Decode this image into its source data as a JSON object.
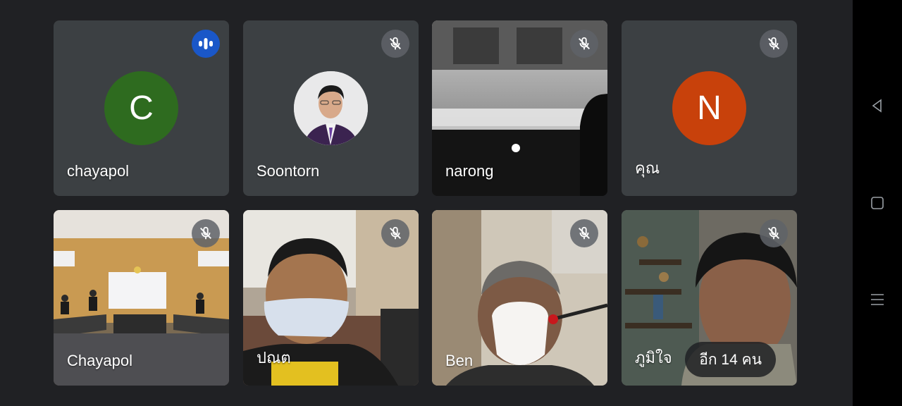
{
  "participants": [
    {
      "name": "chayapol",
      "initial": "C",
      "avatar_color": "#2e6b1f",
      "mic": "speaking"
    },
    {
      "name": "Soontorn",
      "mic": "muted"
    },
    {
      "name": "narong",
      "mic": "muted"
    },
    {
      "name": "คุณ",
      "initial": "N",
      "avatar_color": "#c8410b",
      "mic": "muted"
    },
    {
      "name": "Chayapol",
      "mic": "muted"
    },
    {
      "name": "ปณต",
      "mic": "muted"
    },
    {
      "name": "Ben",
      "mic": "muted"
    },
    {
      "name": "ภูมิใจ",
      "mic": "muted"
    }
  ],
  "more_participants_label": "อีก 14 คน",
  "colors": {
    "speaking": "#1a57c8",
    "muted_bg": "#5f6368",
    "background": "#202124"
  }
}
